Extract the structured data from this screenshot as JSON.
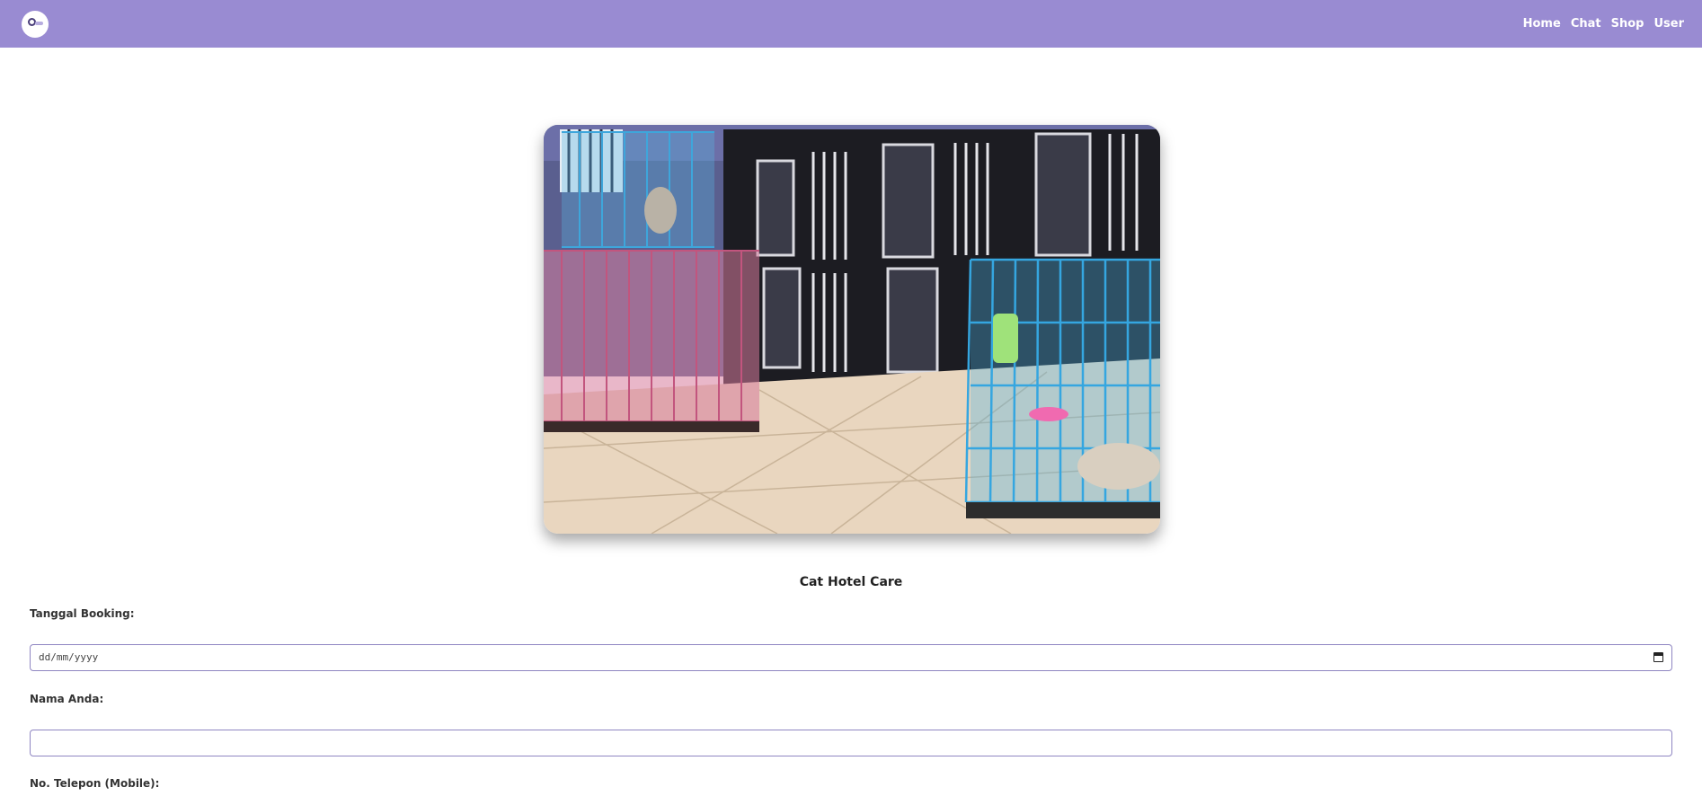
{
  "nav": {
    "logo": "logo",
    "links": [
      "Home",
      "Chat",
      "Shop",
      "User"
    ]
  },
  "hero": {
    "alt_icon": "cat-hotel-photo"
  },
  "title": "Cat Hotel Care",
  "form": {
    "booking_date_label": "Tanggal Booking:",
    "booking_date_placeholder": "dd/mm/yyyy",
    "name_label": "Nama Anda:",
    "name_value": "",
    "phone_label": "No. Telepon (Mobile):"
  },
  "colors": {
    "navbar": "#998bd2",
    "input_border": "#8f86c2"
  }
}
